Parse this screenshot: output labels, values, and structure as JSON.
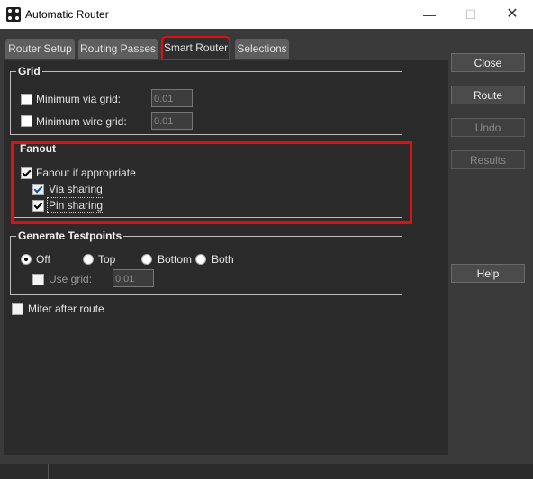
{
  "window": {
    "title": "Automatic Router",
    "minimize": "—",
    "maximize": "☐",
    "close": "✕"
  },
  "tabs": [
    "Router Setup",
    "Routing Passes",
    "Smart Router",
    "Selections"
  ],
  "grid": {
    "label": "Grid",
    "min_via_grid_label": "Minimum via grid:",
    "min_via_grid_value": "0.01",
    "min_wire_grid_label": "Minimum wire grid:",
    "min_wire_grid_value": "0.01"
  },
  "fanout": {
    "label": "Fanout",
    "fanout_if_appropriate": "Fanout if appropriate",
    "via_sharing": "Via sharing",
    "pin_sharing": "Pin sharing"
  },
  "testpoints": {
    "label": "Generate Testpoints",
    "options": [
      "Off",
      "Top",
      "Bottom",
      "Both"
    ],
    "selected": "Off",
    "use_grid_label": "Use grid:",
    "use_grid_value": "0.01"
  },
  "miter_after_route": "Miter after route",
  "buttons": {
    "close": "Close",
    "route": "Route",
    "undo": "Undo",
    "results": "Results",
    "help": "Help"
  },
  "colors": {
    "highlight": "#e01010",
    "panel": "#2b2b2b"
  }
}
